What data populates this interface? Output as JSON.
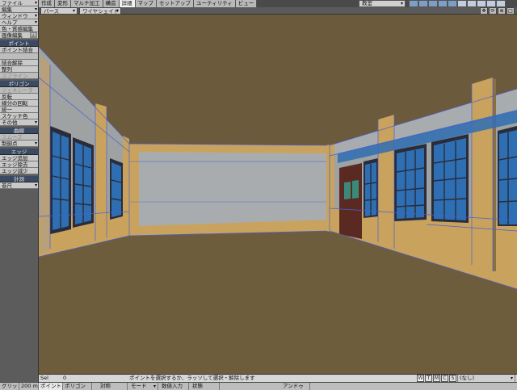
{
  "menu": {
    "top": [
      "ファイル",
      "編集",
      "ウィンドウ",
      "ヘルプ",
      "色・質感編集",
      "画像編集"
    ],
    "top_shortcut": "F5",
    "point_section": "ポイント",
    "point_items": [
      "ポイント結合",
      "",
      "結合解除",
      "整列",
      "スプライン"
    ],
    "polygon_section": "ポリゴン",
    "polygon_items": [
      "ジェネレータ",
      "反転",
      "線分の回転",
      "統一",
      "スケッチ色",
      "その他"
    ],
    "curve_section": "曲線",
    "curve_items": [
      "スムーズ",
      "制御点"
    ],
    "edge_section": "エッジ",
    "edge_items": [
      "エッジ追加",
      "エッジ除去",
      "エッジ減少"
    ],
    "measure_section": "計測",
    "measure_items": [
      "巻尺"
    ]
  },
  "tabs": [
    "作成",
    "変形",
    "マルチ加工",
    "構造",
    "詳細",
    "マップ",
    "セットアップ",
    "ユーティリティ",
    "ビュー"
  ],
  "active_tab": "詳細",
  "scene_select": "教室",
  "viewport": {
    "view_mode": "パース",
    "render_mode": "ワイヤシェイド"
  },
  "selection": {
    "label": "Sel",
    "count": "0",
    "hint": "ポイントを選択するか、ラッソして選択・解除します",
    "wtmcs": [
      "W",
      "T",
      "M",
      "C",
      "S"
    ],
    "layer_select": "(なし)"
  },
  "status": {
    "grid_label": "グリッド",
    "grid_value": "200 mm",
    "point_mode": "ポイント",
    "point_key": "G",
    "polygon_mode": "ポリゴン",
    "symmetry": "対称",
    "mode": "モード",
    "numeric": "数値入力",
    "state": "状態",
    "undo": "アンドゥ"
  },
  "colors": {
    "ceiling": "#6b5a3b",
    "floor": "#6e5d3c",
    "wall_tan": "#c9a35e",
    "wall_gray": "#a9acae",
    "window_blue": "#2e6fb3",
    "frame_dark": "#2a2c3a",
    "door": "#5a2a22",
    "wire": "#4a5fd0"
  }
}
